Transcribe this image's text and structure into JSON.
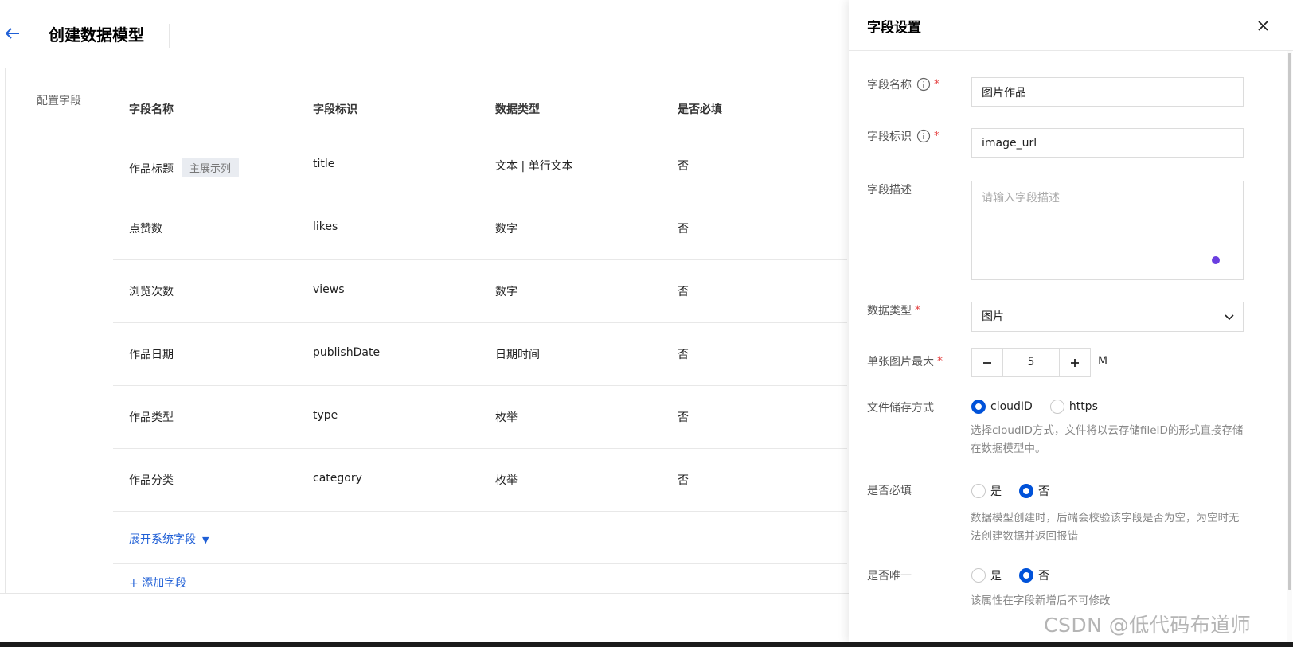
{
  "header": {
    "title": "创建数据模型"
  },
  "section": {
    "label": "配置字段"
  },
  "table": {
    "headers": [
      "字段名称",
      "字段标识",
      "数据类型",
      "是否必填"
    ],
    "rows": [
      {
        "name": "作品标题",
        "badge": "主展示列",
        "id": "title",
        "type": "文本 | 单行文本",
        "required": "否"
      },
      {
        "name": "点赞数",
        "id": "likes",
        "type": "数字",
        "required": "否"
      },
      {
        "name": "浏览次数",
        "id": "views",
        "type": "数字",
        "required": "否"
      },
      {
        "name": "作品日期",
        "id": "publishDate",
        "type": "日期时间",
        "required": "否"
      },
      {
        "name": "作品类型",
        "id": "type",
        "type": "枚举",
        "required": "否"
      },
      {
        "name": "作品分类",
        "id": "category",
        "type": "枚举",
        "required": "否"
      }
    ],
    "expand_label": "展开系统字段",
    "add_label": "+ 添加字段"
  },
  "drawer": {
    "title": "字段设置",
    "field_name": {
      "label": "字段名称",
      "value": "图片作品"
    },
    "field_id": {
      "label": "字段标识",
      "value": "image_url"
    },
    "field_desc": {
      "label": "字段描述",
      "placeholder": "请输入字段描述"
    },
    "data_type": {
      "label": "数据类型",
      "value": "图片"
    },
    "max_size": {
      "label": "单张图片最大",
      "value": "5",
      "unit": "M"
    },
    "storage": {
      "label": "文件储存方式",
      "options": [
        "cloudID",
        "https"
      ],
      "selected": "cloudID",
      "help": "选择cloudID方式，文件将以云存储fileID的形式直接存储在数据模型中。"
    },
    "required": {
      "label": "是否必填",
      "options": [
        "是",
        "否"
      ],
      "selected": "否",
      "help": "数据模型创建时，后端会校验该字段是否为空，为空时无法创建数据并返回报错"
    },
    "unique": {
      "label": "是否唯一",
      "options": [
        "是",
        "否"
      ],
      "selected": "否",
      "help": "该属性在字段新增后不可修改"
    }
  },
  "watermark": "CSDN @低代码布道师",
  "colors": {
    "accent": "#0052d9",
    "link": "#1f5fd6",
    "required": "#e54545"
  }
}
